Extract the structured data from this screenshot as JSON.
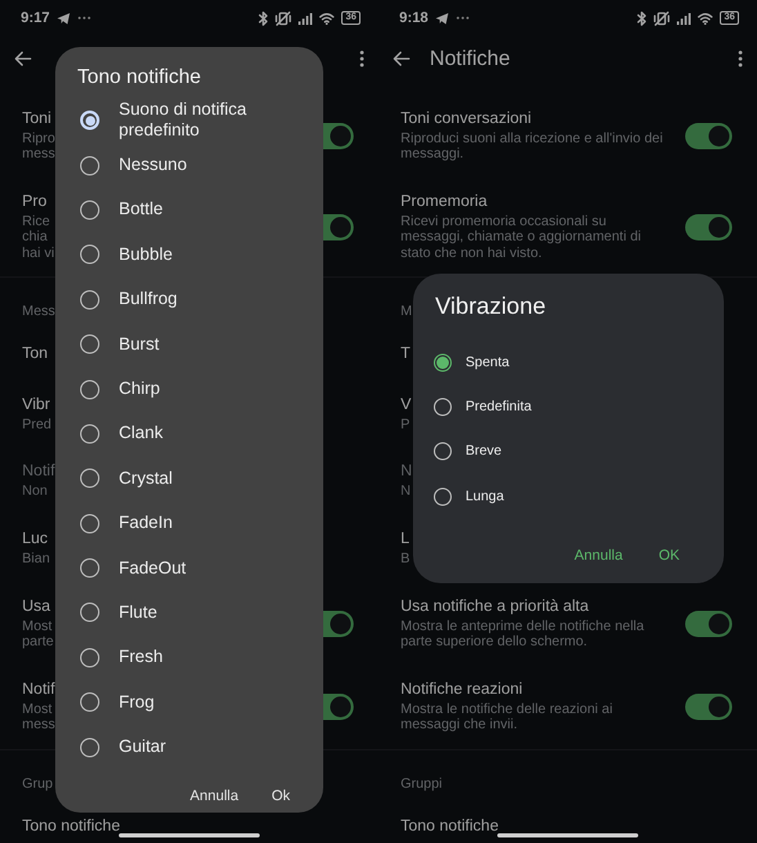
{
  "screens": [
    {
      "status_bar": {
        "time": "9:17",
        "battery": "36"
      },
      "settings": [
        {
          "kind": "toggle",
          "title": "Toni",
          "subtitle": "Ripro\nmess",
          "on": true
        },
        {
          "kind": "toggle",
          "title": "Pro",
          "subtitle": "Rice\nchia\nhai vi",
          "on": true
        },
        {
          "kind": "header",
          "title": "Mess"
        },
        {
          "kind": "plain",
          "title": "Ton"
        },
        {
          "kind": "plain",
          "title": "Vibr",
          "subtitle": "Pred"
        },
        {
          "kind": "plain",
          "title": "Notif",
          "subtitle": "Non",
          "disabled": true
        },
        {
          "kind": "plain",
          "title": "Luc",
          "subtitle": "Bian"
        },
        {
          "kind": "toggle",
          "title": "Usa",
          "subtitle": "Most\nparte",
          "on": true
        },
        {
          "kind": "toggle",
          "title": "Notif",
          "subtitle": "Most\nmess",
          "on": true
        },
        {
          "kind": "header",
          "title": "Grup"
        },
        {
          "kind": "plain",
          "title": "Tono notifiche"
        }
      ],
      "dialog": {
        "kind": "scrolling",
        "title": "Tono notifiche",
        "options": [
          {
            "label": "Suono di notifica predefinito",
            "selected": true
          },
          {
            "label": "Nessuno",
            "selected": false
          },
          {
            "label": "Bottle",
            "selected": false
          },
          {
            "label": "Bubble",
            "selected": false
          },
          {
            "label": "Bullfrog",
            "selected": false
          },
          {
            "label": "Burst",
            "selected": false
          },
          {
            "label": "Chirp",
            "selected": false
          },
          {
            "label": "Clank",
            "selected": false
          },
          {
            "label": "Crystal",
            "selected": false
          },
          {
            "label": "FadeIn",
            "selected": false
          },
          {
            "label": "FadeOut",
            "selected": false
          },
          {
            "label": "Flute",
            "selected": false
          },
          {
            "label": "Fresh",
            "selected": false
          },
          {
            "label": "Frog",
            "selected": false
          },
          {
            "label": "Guitar",
            "selected": false
          }
        ],
        "buttons": [
          "Annulla",
          "Ok"
        ]
      }
    },
    {
      "status_bar": {
        "time": "9:18",
        "battery": "36"
      },
      "app_bar": {
        "title": "Notifiche"
      },
      "settings": [
        {
          "kind": "toggle",
          "title": "Toni conversazioni",
          "subtitle": "Riproduci suoni alla ricezione e all'invio dei messaggi.",
          "on": true
        },
        {
          "kind": "toggle",
          "title": "Promemoria",
          "subtitle": "Ricevi promemoria occasionali su messaggi, chiamate o aggiornamenti di stato che non hai visto.",
          "on": true
        },
        {
          "kind": "header",
          "title": "M"
        },
        {
          "kind": "plain",
          "title": "T"
        },
        {
          "kind": "plain",
          "title": "V",
          "subtitle": "P"
        },
        {
          "kind": "plain",
          "title": "N",
          "subtitle": "N",
          "disabled": true
        },
        {
          "kind": "plain",
          "title": "L",
          "subtitle": "B"
        },
        {
          "kind": "toggle",
          "title": "Usa notifiche a priorità alta",
          "subtitle": "Mostra le anteprime delle notifiche nella parte superiore dello schermo.",
          "on": true
        },
        {
          "kind": "toggle",
          "title": "Notifiche reazioni",
          "subtitle": "Mostra le notifiche delle reazioni ai messaggi che invii.",
          "on": true
        },
        {
          "kind": "header",
          "title": "Gruppi"
        },
        {
          "kind": "plain",
          "title": "Tono notifiche"
        }
      ],
      "dialog": {
        "kind": "simple",
        "title": "Vibrazione",
        "options": [
          {
            "label": "Spenta",
            "selected": true
          },
          {
            "label": "Predefinita",
            "selected": false
          },
          {
            "label": "Breve",
            "selected": false
          },
          {
            "label": "Lunga",
            "selected": false
          }
        ],
        "buttons": [
          "Annulla",
          "OK"
        ]
      }
    }
  ]
}
